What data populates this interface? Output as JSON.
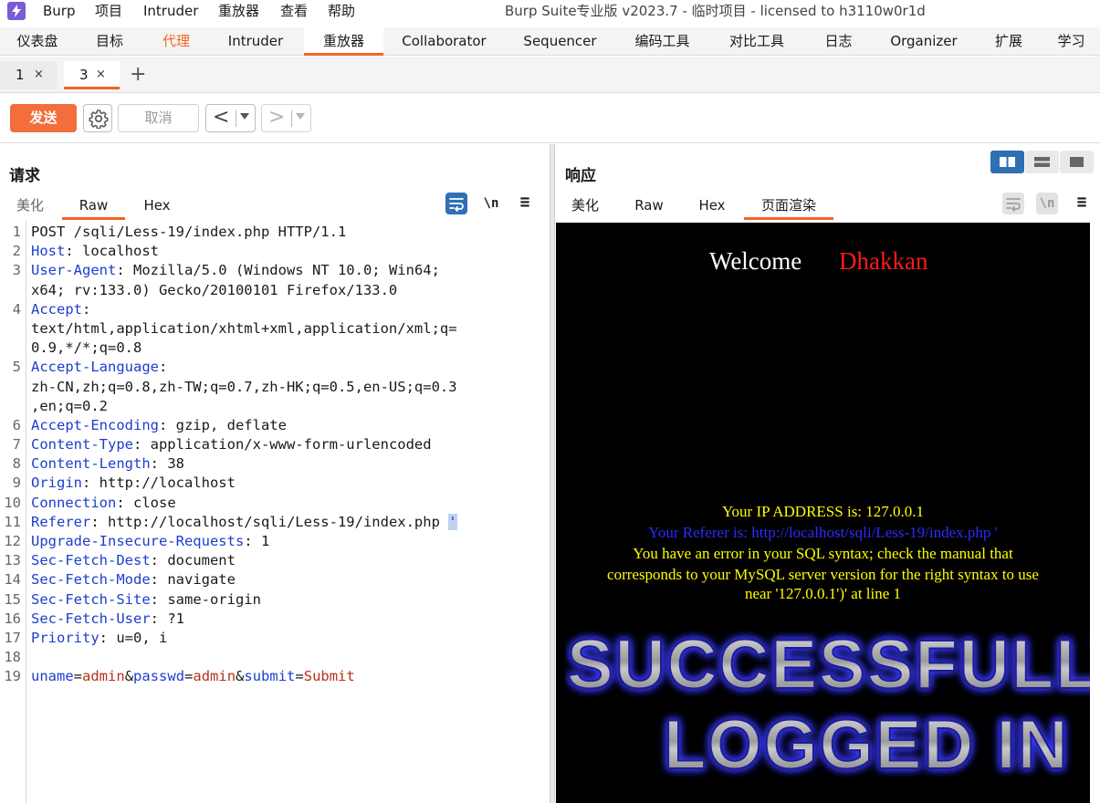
{
  "menubar": {
    "items": [
      "Burp",
      "项目",
      "Intruder",
      "重放器",
      "查看",
      "帮助"
    ],
    "window_title": "Burp Suite专业版  v2023.7 - 临时项目 - licensed to h3110w0r1d"
  },
  "tool_tabs": [
    "仪表盘",
    "目标",
    "代理",
    "Intruder",
    "重放器",
    "Collaborator",
    "Sequencer",
    "编码工具",
    "对比工具",
    "日志",
    "Organizer",
    "扩展",
    "学习"
  ],
  "active_tool_tab": "重放器",
  "repeater_tabs": [
    {
      "label": "1",
      "close": "×"
    },
    {
      "label": "3",
      "close": "×"
    }
  ],
  "add_tab_symbol": "+",
  "toolbar": {
    "send_label": "发送",
    "cancel_label": "取消",
    "back_symbol": "<",
    "forward_symbol": ">"
  },
  "request": {
    "title": "请求",
    "tabs": [
      "美化",
      "Raw",
      "Hex"
    ],
    "active_tab": "Raw",
    "newline_icon_label": "\\n",
    "menu_icon_label": "≡",
    "lines": [
      {
        "n": "1",
        "segments": [
          [
            "",
            "POST /sqli/Less-19/index.php HTTP/1.1"
          ]
        ]
      },
      {
        "n": "2",
        "segments": [
          [
            "hk",
            "Host"
          ],
          [
            "",
            ": localhost"
          ]
        ]
      },
      {
        "n": "3",
        "segments": [
          [
            "hk",
            "User-Agent"
          ],
          [
            "",
            ": Mozilla/5.0 (Windows NT 10.0; Win64;"
          ]
        ]
      },
      {
        "n": "",
        "segments": [
          [
            "",
            "x64; rv:133.0) Gecko/20100101 Firefox/133.0"
          ]
        ]
      },
      {
        "n": "4",
        "segments": [
          [
            "hk",
            "Accept"
          ],
          [
            "",
            ":"
          ]
        ]
      },
      {
        "n": "",
        "segments": [
          [
            "",
            "text/html,application/xhtml+xml,application/xml;q="
          ]
        ]
      },
      {
        "n": "",
        "segments": [
          [
            "",
            "0.9,*/*;q=0.8"
          ]
        ]
      },
      {
        "n": "5",
        "segments": [
          [
            "hk",
            "Accept-Language"
          ],
          [
            "",
            ":"
          ]
        ]
      },
      {
        "n": "",
        "segments": [
          [
            "",
            "zh-CN,zh;q=0.8,zh-TW;q=0.7,zh-HK;q=0.5,en-US;q=0.3"
          ]
        ]
      },
      {
        "n": "",
        "segments": [
          [
            "",
            ",en;q=0.2"
          ]
        ]
      },
      {
        "n": "6",
        "segments": [
          [
            "hk",
            "Accept-Encoding"
          ],
          [
            "",
            ": gzip, deflate"
          ]
        ]
      },
      {
        "n": "7",
        "segments": [
          [
            "hk",
            "Content-Type"
          ],
          [
            "",
            ": application/x-www-form-urlencoded"
          ]
        ]
      },
      {
        "n": "8",
        "segments": [
          [
            "hk",
            "Content-Length"
          ],
          [
            "",
            ": 38"
          ]
        ]
      },
      {
        "n": "9",
        "segments": [
          [
            "hk",
            "Origin"
          ],
          [
            "",
            ": http://localhost"
          ]
        ]
      },
      {
        "n": "10",
        "segments": [
          [
            "hk",
            "Connection"
          ],
          [
            "",
            ": close"
          ]
        ]
      },
      {
        "n": "11",
        "segments": [
          [
            "hk",
            "Referer"
          ],
          [
            "",
            ": http://localhost/sqli/Less-19/index.php "
          ],
          [
            "caret-mark",
            "'"
          ]
        ]
      },
      {
        "n": "12",
        "segments": [
          [
            "hk",
            "Upgrade-Insecure-Requests"
          ],
          [
            "",
            ": 1"
          ]
        ]
      },
      {
        "n": "13",
        "segments": [
          [
            "hk",
            "Sec-Fetch-Dest"
          ],
          [
            "",
            ": document"
          ]
        ]
      },
      {
        "n": "14",
        "segments": [
          [
            "hk",
            "Sec-Fetch-Mode"
          ],
          [
            "",
            ": navigate"
          ]
        ]
      },
      {
        "n": "15",
        "segments": [
          [
            "hk",
            "Sec-Fetch-Site"
          ],
          [
            "",
            ": same-origin"
          ]
        ]
      },
      {
        "n": "16",
        "segments": [
          [
            "hk",
            "Sec-Fetch-User"
          ],
          [
            "",
            ": ?1"
          ]
        ]
      },
      {
        "n": "17",
        "segments": [
          [
            "hk",
            "Priority"
          ],
          [
            "",
            ": u=0, i"
          ]
        ]
      },
      {
        "n": "18",
        "segments": [
          [
            "",
            ""
          ]
        ]
      },
      {
        "n": "19",
        "segments": [
          [
            "pk",
            "uname"
          ],
          [
            "eq",
            "="
          ],
          [
            "pv",
            "admin"
          ],
          [
            "eq",
            "&"
          ],
          [
            "pk",
            "passwd"
          ],
          [
            "eq",
            "="
          ],
          [
            "pv",
            "admin"
          ],
          [
            "eq",
            "&"
          ],
          [
            "pk",
            "submit"
          ],
          [
            "eq",
            "="
          ],
          [
            "pv",
            "Submit"
          ]
        ]
      }
    ]
  },
  "response": {
    "title": "响应",
    "tabs": [
      "美化",
      "Raw",
      "Hex",
      "页面渲染"
    ],
    "active_tab": "页面渲染",
    "newline_icon_label": "\\n",
    "menu_icon_label": "≡",
    "render": {
      "welcome_word": "Welcome",
      "welcome_name": "Dhakkan",
      "ip_line": "Your IP ADDRESS is: 127.0.0.1",
      "referer_line": "Your Referer is: http://localhost/sqli/Less-19/index.php '",
      "error_lines": [
        "You have an error in your SQL syntax; check the manual that",
        "corresponds to your MySQL server version for the right syntax to use",
        "near '127.0.0.1')' at line 1"
      ],
      "image_line1": "SUCCESSFULLY",
      "image_line2": "LOGGED IN"
    }
  },
  "colors": {
    "accent": "#f26522",
    "send_button": "#f26e3a",
    "header_key": "#1c3ecf",
    "param_value": "#b8301a",
    "toggle_active": "#2f6fb3"
  }
}
